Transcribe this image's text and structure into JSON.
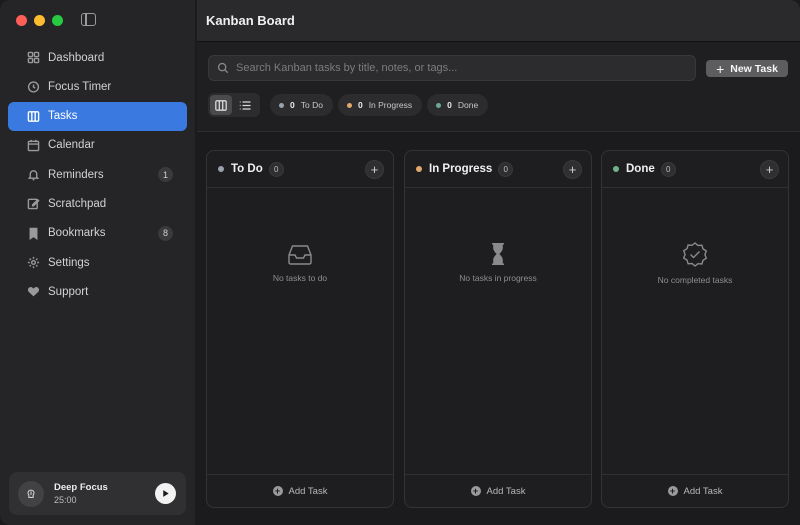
{
  "window": {
    "title": "Kanban Board"
  },
  "sidebar": {
    "items": [
      {
        "label": "Dashboard",
        "icon": "grid-icon",
        "badge": ""
      },
      {
        "label": "Focus Timer",
        "icon": "timer-icon",
        "badge": ""
      },
      {
        "label": "Tasks",
        "icon": "columns-icon",
        "badge": "",
        "active": true
      },
      {
        "label": "Calendar",
        "icon": "calendar-icon",
        "badge": ""
      },
      {
        "label": "Reminders",
        "icon": "bell-icon",
        "badge": "1"
      },
      {
        "label": "Scratchpad",
        "icon": "edit-icon",
        "badge": ""
      },
      {
        "label": "Bookmarks",
        "icon": "bookmark-icon",
        "badge": "8"
      },
      {
        "label": "Settings",
        "icon": "gear-icon",
        "badge": ""
      },
      {
        "label": "Support",
        "icon": "heart-icon",
        "badge": ""
      }
    ],
    "focus": {
      "title": "Deep Focus",
      "time": "25:00"
    }
  },
  "toolbar": {
    "search_placeholder": "Search Kanban tasks by title, notes, or tags...",
    "new_task_label": "New Task",
    "counts": [
      {
        "num": "0",
        "label": "To Do",
        "color": "#9aa3ad"
      },
      {
        "num": "0",
        "label": "In Progress",
        "color": "#e0a96b"
      },
      {
        "num": "0",
        "label": "Done",
        "color": "#6fa79a"
      }
    ]
  },
  "columns": [
    {
      "title": "To Do",
      "count": "0",
      "color": "#9aa3ad",
      "empty_text": "No tasks to do",
      "icon": "inbox-icon",
      "add_label": "Add Task"
    },
    {
      "title": "In Progress",
      "count": "0",
      "color": "#e0a96b",
      "empty_text": "No tasks in progress",
      "icon": "hourglass-icon",
      "add_label": "Add Task"
    },
    {
      "title": "Done",
      "count": "0",
      "color": "#6fb38a",
      "empty_text": "No completed tasks",
      "icon": "check-badge-icon",
      "add_label": "Add Task"
    }
  ],
  "colors": {
    "accent": "#3a7ae0"
  }
}
